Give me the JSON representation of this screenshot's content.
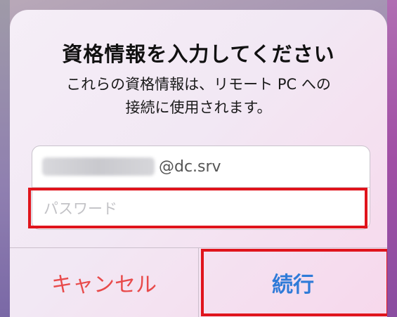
{
  "dialog": {
    "title": "資格情報を入力してください",
    "message": "これらの資格情報は、リモート PC への\n接続に使用されます。",
    "username": {
      "domain_suffix": "@dc.srv"
    },
    "password": {
      "placeholder": "パスワード"
    },
    "buttons": {
      "cancel_label": "キャンセル",
      "continue_label": "続行"
    }
  },
  "colors": {
    "cancel": "#e84a4a",
    "continue": "#2f7bd8",
    "highlight": "#e0141c"
  }
}
